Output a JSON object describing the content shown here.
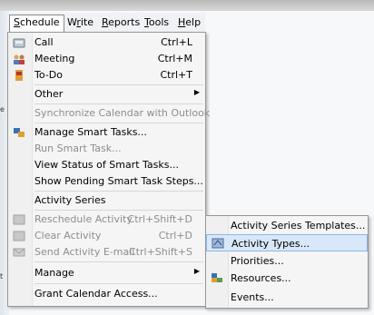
{
  "menubar": {
    "items": [
      {
        "label": "Schedule",
        "u": "S"
      },
      {
        "label": "Write",
        "u": "r"
      },
      {
        "label": "Reports",
        "u": "R"
      },
      {
        "label": "Tools",
        "u": "T"
      },
      {
        "label": "Help",
        "u": "H"
      }
    ]
  },
  "menu": {
    "items": [
      {
        "label": "Call",
        "shortcut": "Ctrl+L",
        "icon": "phone-icon"
      },
      {
        "label": "Meeting",
        "shortcut": "Ctrl+M",
        "icon": "people-icon"
      },
      {
        "label": "To-Do",
        "shortcut": "Ctrl+T",
        "icon": "todo-icon"
      },
      {
        "label": "Other",
        "has_submenu": true
      },
      {
        "label": "Synchronize Calendar with Outlook",
        "disabled": true
      },
      {
        "label": "Manage Smart Tasks...",
        "icon": "smart-tasks-icon"
      },
      {
        "label": "Run Smart Task...",
        "disabled": true
      },
      {
        "label": "View Status of Smart Tasks..."
      },
      {
        "label": "Show Pending Smart Task Steps..."
      },
      {
        "label": "Activity Series"
      },
      {
        "label": "Reschedule Activity",
        "shortcut": "Ctrl+Shift+D",
        "disabled": true,
        "icon": "reschedule-icon"
      },
      {
        "label": "Clear Activity",
        "shortcut": "Ctrl+D",
        "disabled": true,
        "icon": "clear-icon"
      },
      {
        "label": "Send Activity E-mail",
        "shortcut": "Ctrl+Shift+S",
        "disabled": true,
        "icon": "email-icon"
      },
      {
        "label": "Manage",
        "has_submenu": true
      },
      {
        "label": "Grant Calendar Access..."
      }
    ]
  },
  "submenu": {
    "items": [
      {
        "label": "Activity Series Templates..."
      },
      {
        "label": "Activity Types...",
        "highlighted": true,
        "icon": "activity-types-icon"
      },
      {
        "label": "Priorities..."
      },
      {
        "label": "Resources...",
        "icon": "resources-icon"
      },
      {
        "label": "Events..."
      }
    ]
  },
  "left_strip": {
    "labels": [
      "e",
      "t"
    ]
  }
}
